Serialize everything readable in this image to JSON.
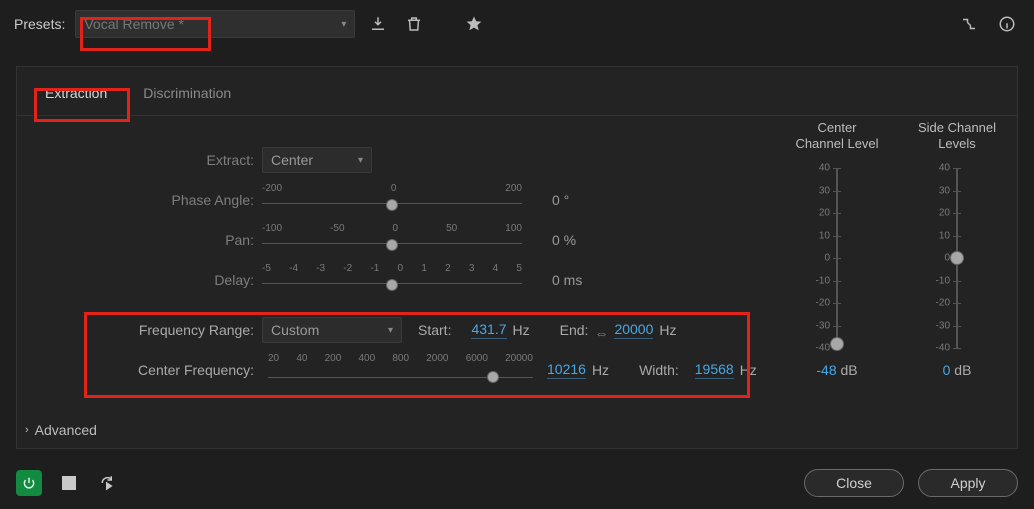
{
  "header": {
    "presets_label": "Presets:",
    "preset_name": "Vocal Remove *"
  },
  "tabs": [
    {
      "label": "Extraction",
      "active": true
    },
    {
      "label": "Discrimination",
      "active": false
    }
  ],
  "controls": {
    "extract": {
      "label": "Extract:",
      "value": "Center"
    },
    "phase": {
      "label": "Phase Angle:",
      "ticks": [
        "-200",
        "0",
        "200"
      ],
      "knob_pct": 50,
      "value": "0 °"
    },
    "pan": {
      "label": "Pan:",
      "ticks": [
        "-100",
        "-50",
        "0",
        "50",
        "100"
      ],
      "knob_pct": 50,
      "value": "0 %"
    },
    "delay": {
      "label": "Delay:",
      "ticks": [
        "-5",
        "-4",
        "-3",
        "-2",
        "-1",
        "0",
        "1",
        "2",
        "3",
        "4",
        "5"
      ],
      "knob_pct": 50,
      "value": "0 ms"
    },
    "freq_range": {
      "label": "Frequency Range:",
      "value": "Custom",
      "start_label": "Start:",
      "start_value": "431.7",
      "start_unit": "Hz",
      "end_label": "End:",
      "end_value": "20000",
      "end_unit": "Hz"
    },
    "center_freq": {
      "label": "Center Frequency:",
      "ticks": [
        "20",
        "40",
        "200",
        "400",
        "800",
        "2000",
        "6000",
        "20000"
      ],
      "knob_pct": 85,
      "value": "10216",
      "unit": "Hz",
      "width_label": "Width:",
      "width_value": "19568",
      "width_unit": "Hz"
    }
  },
  "meters": {
    "center": {
      "title1": "Center",
      "title2": "Channel Level",
      "knob_pct": 98,
      "value": "-48",
      "unit": "dB"
    },
    "side": {
      "title1": "Side Channel",
      "title2": "Levels",
      "knob_pct": 50,
      "value": "0",
      "unit": "dB"
    },
    "ticks": [
      "40",
      "30",
      "20",
      "10",
      "0",
      "-10",
      "-20",
      "-30",
      "-40"
    ]
  },
  "advanced_label": "Advanced",
  "footer": {
    "close": "Close",
    "apply": "Apply"
  }
}
